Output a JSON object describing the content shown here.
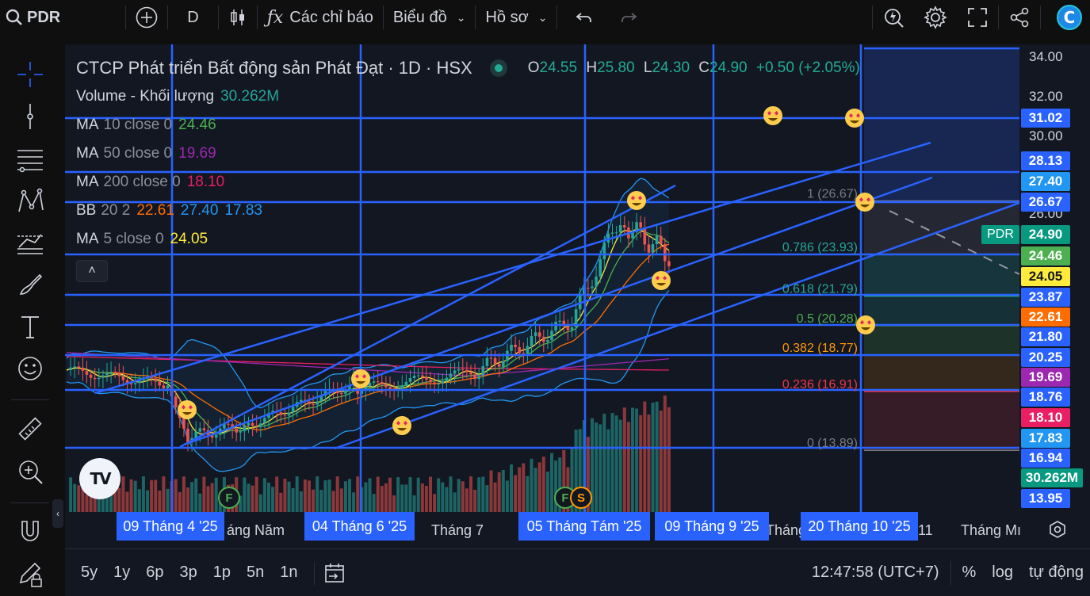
{
  "topbar": {
    "symbol": "PDR",
    "interval": "D",
    "indicators_label": "Các chỉ báo",
    "chart_type_label": "Biểu đồ",
    "profile_label": "Hồ sơ"
  },
  "legend": {
    "title": "CTCP Phát triển Bất động sản Phát Đạt · 1D · HSX",
    "o_label": "O",
    "o": "24.55",
    "h_label": "H",
    "h": "25.80",
    "l_label": "L",
    "l": "24.30",
    "c_label": "C",
    "c": "24.90",
    "change": "+0.50 (+2.05%)",
    "rows": [
      {
        "label": "Volume - Khối lượng",
        "params": "",
        "values": [
          "30.262M"
        ],
        "colors": [
          "#26a69a"
        ]
      },
      {
        "label": "MA",
        "params": "10 close 0",
        "values": [
          "24.46"
        ],
        "colors": [
          "#4caf50"
        ]
      },
      {
        "label": "MA",
        "params": "50 close 0",
        "values": [
          "19.69"
        ],
        "colors": [
          "#9c27b0"
        ]
      },
      {
        "label": "MA",
        "params": "200 close 0",
        "values": [
          "18.10"
        ],
        "colors": [
          "#e91e63"
        ]
      },
      {
        "label": "BB",
        "params": "20 2",
        "values": [
          "22.61",
          "27.40",
          "17.83"
        ],
        "colors": [
          "#ff6d00",
          "#2196f3",
          "#2196f3"
        ]
      },
      {
        "label": "MA",
        "params": "5 close 0",
        "values": [
          "24.05"
        ],
        "colors": [
          "#ffeb3b"
        ]
      }
    ]
  },
  "fib": [
    {
      "label": "1 (26.67)",
      "level": 26.67,
      "color": "#787b86"
    },
    {
      "label": "0.786 (23.93)",
      "level": 23.93,
      "color": "#26a69a"
    },
    {
      "label": "0.618 (21.79)",
      "level": 21.79,
      "color": "#26a69a"
    },
    {
      "label": "0.5 (20.28)",
      "level": 20.28,
      "color": "#4caf50"
    },
    {
      "label": "0.382 (18.77)",
      "level": 18.77,
      "color": "#ff9800"
    },
    {
      "label": "0.236 (16.91)",
      "level": 16.91,
      "color": "#f23645"
    },
    {
      "label": "0 (13.89)",
      "level": 13.89,
      "color": "#787b86"
    }
  ],
  "price_axis": {
    "ticks": [
      "34.00",
      "32.00",
      "30.00",
      "26.00"
    ],
    "badges": [
      {
        "text": "31.02",
        "color": "#2962ff"
      },
      {
        "text": "28.13",
        "color": "#2962ff"
      },
      {
        "text": "27.40",
        "color": "#2196f3"
      },
      {
        "text": "26.67",
        "color": "#2962ff"
      },
      {
        "text": "24.90",
        "color": "#089981"
      },
      {
        "text": "24.46",
        "color": "#4caf50"
      },
      {
        "text": "24.05",
        "color": "#ffeb3b"
      },
      {
        "text": "23.87",
        "color": "#2962ff"
      },
      {
        "text": "22.61",
        "color": "#ff6d00"
      },
      {
        "text": "21.80",
        "color": "#2962ff"
      },
      {
        "text": "20.25",
        "color": "#2962ff"
      },
      {
        "text": "19.69",
        "color": "#9c27b0"
      },
      {
        "text": "18.76",
        "color": "#2962ff"
      },
      {
        "text": "18.10",
        "color": "#e91e63"
      },
      {
        "text": "17.83",
        "color": "#2196f3"
      },
      {
        "text": "16.94",
        "color": "#2962ff"
      },
      {
        "text": "30.262M",
        "color": "#089981"
      },
      {
        "text": "13.95",
        "color": "#2962ff"
      }
    ],
    "symbol_tag": "PDR"
  },
  "date_axis": {
    "ticks": [
      "áng Năm",
      "Tháng 7",
      "Tháng",
      "11",
      "Tháng Mı"
    ],
    "badges": [
      "09 Tháng 4 '25",
      "04 Tháng 6 '25",
      "05 Tháng Tám '25",
      "09 Tháng 9 '25",
      "20 Tháng 10 '25"
    ]
  },
  "events": [
    "F",
    "F",
    "S"
  ],
  "bottombar": {
    "ranges": [
      "5y",
      "1y",
      "6p",
      "3p",
      "1p",
      "5n",
      "1n"
    ],
    "time": "12:47:58 (UTC+7)",
    "percent": "%",
    "log": "log",
    "auto": "tự động"
  },
  "colors": {
    "up": "#26a69a",
    "down": "#ef5350",
    "drawing": "#2962ff",
    "background": "#131722"
  }
}
